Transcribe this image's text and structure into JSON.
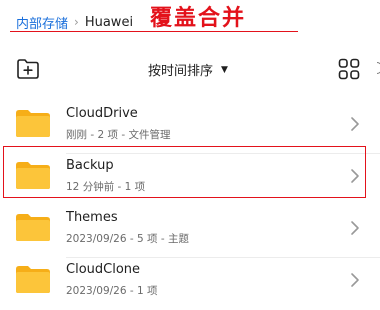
{
  "breadcrumb": {
    "root": "内部存储",
    "separator": "›",
    "current": "Huawei"
  },
  "annotation": {
    "title": "覆盖合并",
    "color": "#e3121b"
  },
  "toolbar": {
    "new_folder_icon": "folder-plus-icon",
    "sort_label": "按时间排序",
    "sort_arrow": "▼",
    "view_icon": "grid-view-icon"
  },
  "files": [
    {
      "name": "CloudDrive",
      "meta": "刚刚 - 2 项 - 文件管理",
      "icon": "folder-icon"
    },
    {
      "name": "Backup",
      "meta": "12 分钟前 - 1 项",
      "icon": "folder-icon",
      "highlighted": true
    },
    {
      "name": "Themes",
      "meta": "2023/09/26 - 5 项 - 主题",
      "icon": "folder-icon"
    },
    {
      "name": "CloudClone",
      "meta": "2023/09/26 - 1 项",
      "icon": "folder-icon"
    }
  ],
  "colors": {
    "link": "#1a6fdb",
    "folder": "#fbbf2c",
    "annotation": "#e3121b"
  }
}
